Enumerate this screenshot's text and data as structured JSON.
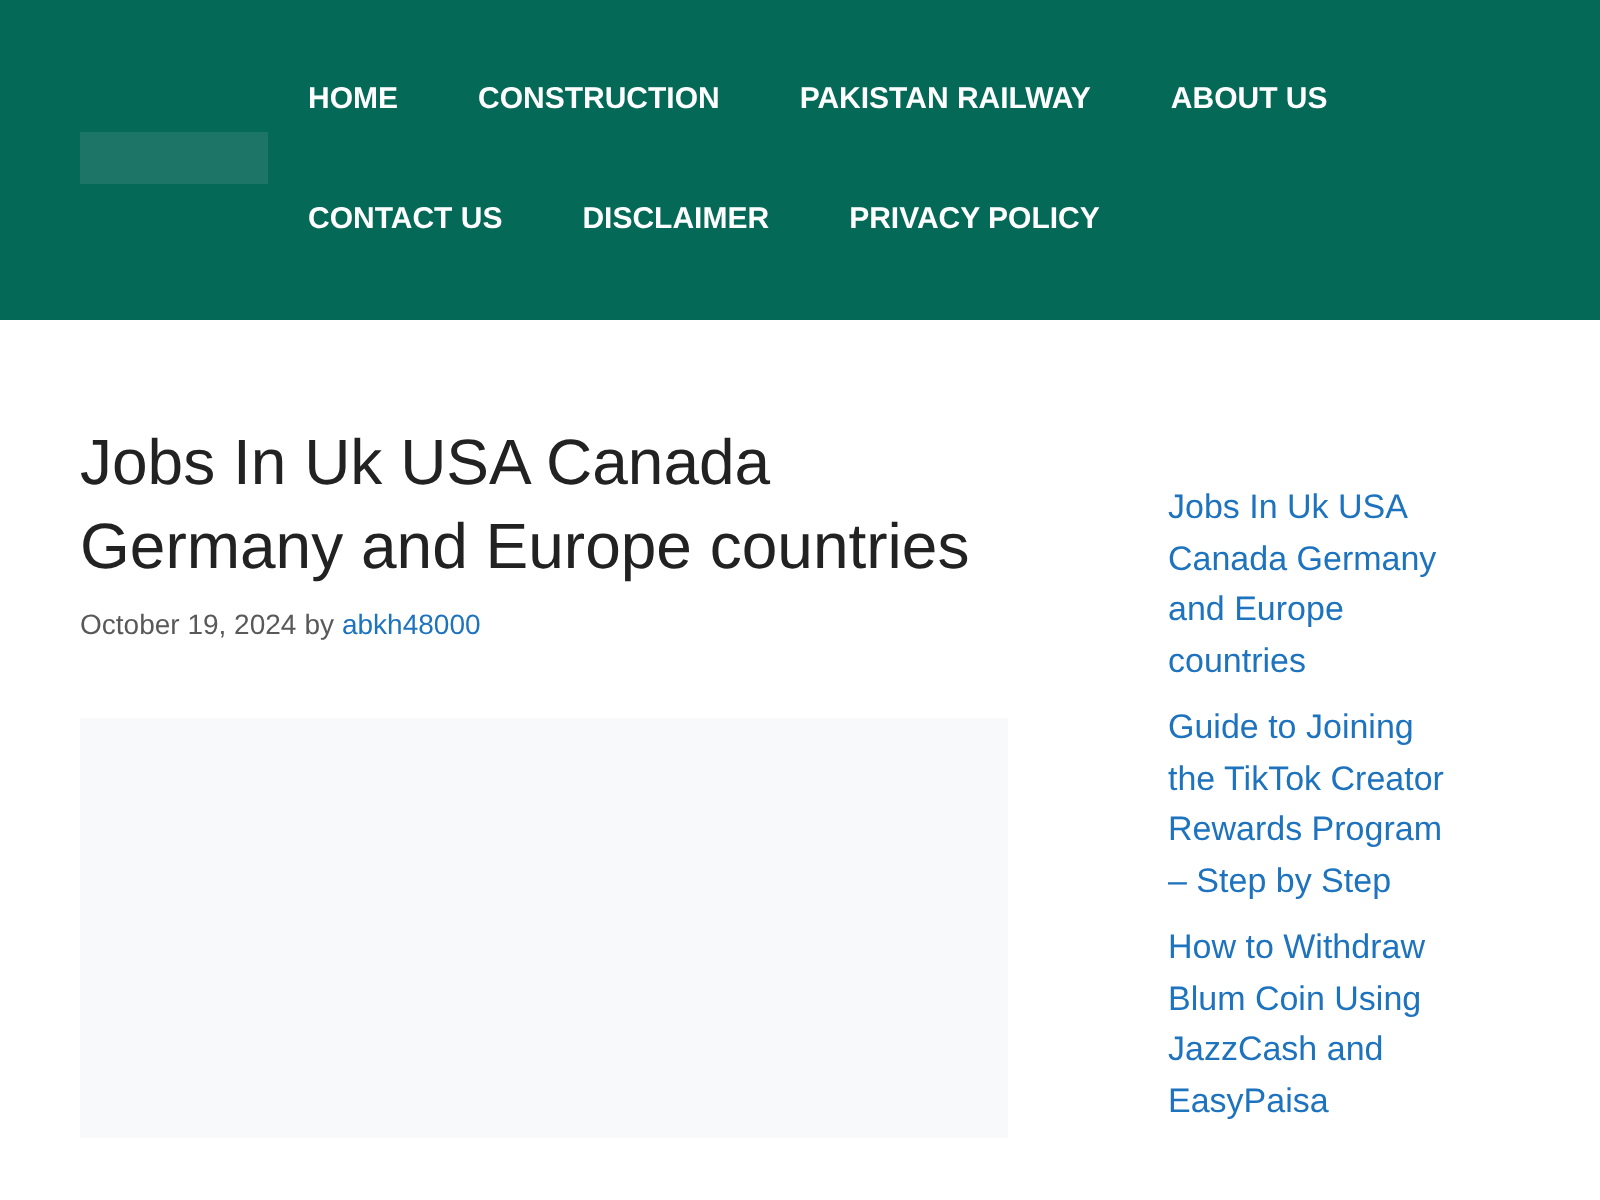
{
  "nav": {
    "items": [
      {
        "label": "HOME"
      },
      {
        "label": "CONSTRUCTION"
      },
      {
        "label": "PAKISTAN RAILWAY"
      },
      {
        "label": "ABOUT US"
      },
      {
        "label": "CONTACT US"
      },
      {
        "label": "DISCLAIMER"
      },
      {
        "label": "PRIVACY POLICY"
      }
    ]
  },
  "article": {
    "title": "Jobs In Uk USA Canada Germany and Europe countries",
    "date": "October 19, 2024",
    "by": "by",
    "author": "abkh48000"
  },
  "sidebar": {
    "links": [
      "Jobs In Uk USA Canada Germany and Europe countries",
      "Guide to Joining the TikTok Creator Rewards Program – Step by Step",
      "How to Withdraw Blum Coin Using JazzCash and EasyPaisa"
    ]
  }
}
